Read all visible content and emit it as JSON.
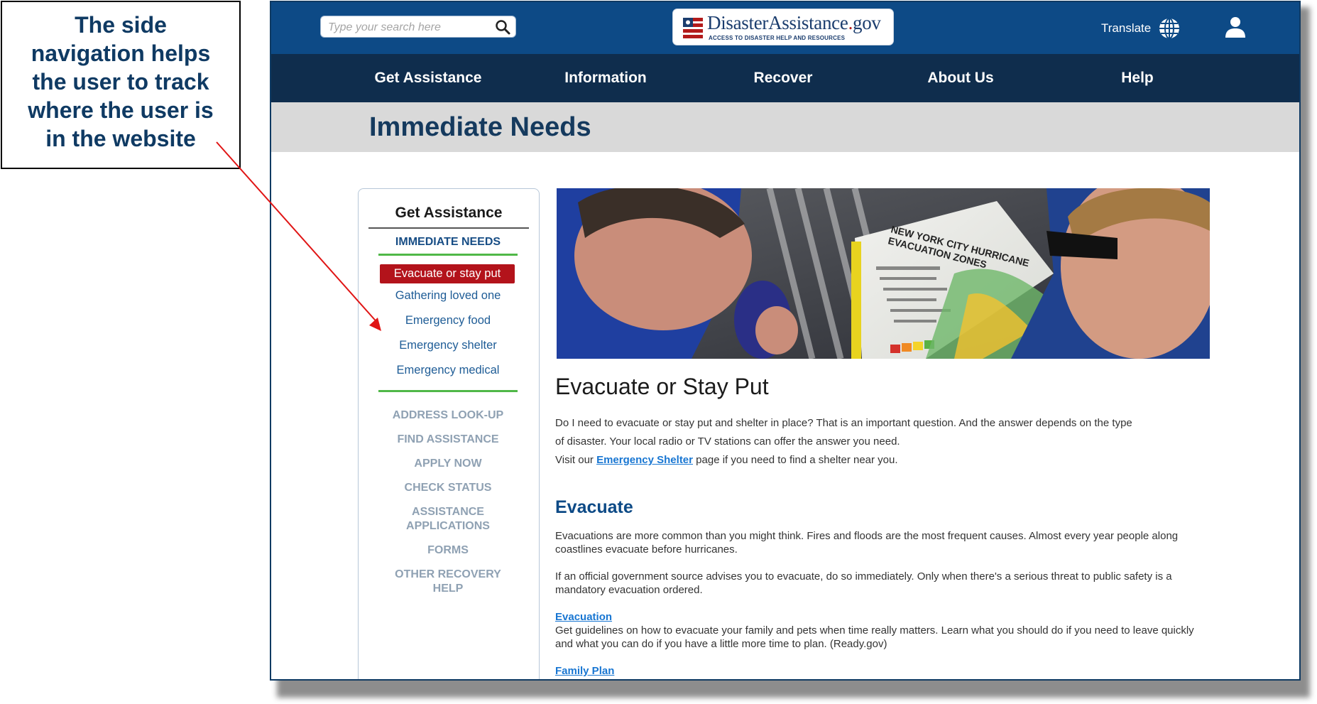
{
  "callout": {
    "text": "The side navigation helps the user to track where the user is in the website"
  },
  "header": {
    "search_placeholder": "Type your search here",
    "logo_main": "DisasterAssistance",
    "logo_dot": ".",
    "logo_gov": "gov",
    "logo_tagline": "ACCESS TO DISASTER HELP AND RESOURCES",
    "translate_label": "Translate"
  },
  "nav": {
    "items": [
      {
        "label": "Get Assistance"
      },
      {
        "label": "Information"
      },
      {
        "label": "Recover"
      },
      {
        "label": "About Us"
      },
      {
        "label": "Help"
      }
    ]
  },
  "page": {
    "title": "Immediate Needs"
  },
  "sidebar": {
    "heading": "Get Assistance",
    "category": "IMMEDIATE NEEDS",
    "subitems": [
      {
        "label": "Evacuate or stay put",
        "active": true
      },
      {
        "label": "Gathering loved one",
        "active": false
      },
      {
        "label": "Emergency food",
        "active": false
      },
      {
        "label": "Emergency shelter",
        "active": false
      },
      {
        "label": "Emergency medical",
        "active": false
      }
    ],
    "sections": [
      {
        "label": "ADDRESS LOOK-UP"
      },
      {
        "label": "FIND ASSISTANCE"
      },
      {
        "label": "APPLY NOW"
      },
      {
        "label": "CHECK STATUS"
      },
      {
        "label": "ASSISTANCE APPLICATIONS"
      },
      {
        "label": "FORMS"
      },
      {
        "label": "OTHER RECOVERY HELP"
      }
    ]
  },
  "hero": {
    "map_title_line1": "NEW YORK CITY HURRICANE",
    "map_title_line2": "EVACUATION ZONES"
  },
  "content": {
    "title": "Evacuate or Stay Put",
    "intro_line1": "Do I need to evacuate or stay put and shelter in place? That is an important question. And the answer depends on the type",
    "intro_line2": "of disaster. Your local radio or TV stations can offer the answer you need.",
    "visit_prefix": "Visit our ",
    "visit_link": "Emergency Shelter",
    "visit_suffix": " page if you need to find a shelter near you.",
    "evacuate_heading": "Evacuate",
    "evac_p1": "Evacuations are more common than you might think. Fires and floods are the most frequent causes. Almost every year people along coastlines evacuate before hurricanes.",
    "evac_p2": "If an official government source advises you to evacuate, do so immediately. Only when there's a serious threat to public safety is a mandatory evacuation ordered.",
    "resource1_link": "Evacuation",
    "resource1_desc": "Get guidelines on how to evacuate your family and pets when time really matters. Learn what you should do if you need to leave quickly and what you can do if you have a little more time to plan. (Ready.gov)",
    "resource2_link": "Family Plan"
  },
  "colors": {
    "header_blue": "#0d4a86",
    "nav_dark": "#0f2d4d",
    "active_red": "#b3131b",
    "accent_green": "#50b848",
    "link_blue": "#1876d2",
    "muted_section": "#8fa1b3"
  }
}
